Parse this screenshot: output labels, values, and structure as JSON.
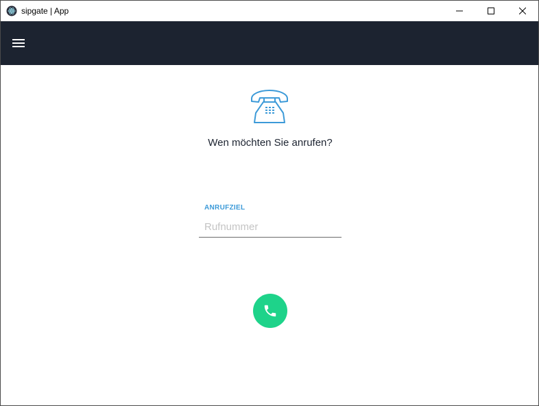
{
  "window": {
    "title": "sipgate | App",
    "controls": [
      "minimize",
      "maximize",
      "close"
    ]
  },
  "header": {
    "menu_icon": "hamburger-menu-icon",
    "background_color": "#1c2330"
  },
  "main": {
    "illustration_icon": "telephone-icon",
    "prompt": "Wen möchten Sie anrufen?",
    "field": {
      "label": "ANRUFZIEL",
      "placeholder": "Rufnummer",
      "value": ""
    },
    "call_button_icon": "phone-icon",
    "accent_color": "#3c9ad8",
    "call_color": "#1ed38a"
  }
}
